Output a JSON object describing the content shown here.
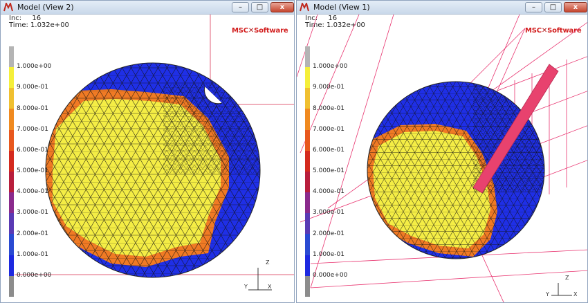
{
  "windows": [
    {
      "title": "Model (View 2)",
      "inc_label": "Inc:",
      "inc_value": "16",
      "time_label": "Time:",
      "time_value": "1.032e+00",
      "axis_labels": [
        "Z",
        "Y",
        "X"
      ]
    },
    {
      "title": "Model (View 1)",
      "inc_label": "Inc:",
      "inc_value": "16",
      "time_label": "Time:",
      "time_value": "1.032e+00",
      "axis_labels": [
        "Z",
        "Y",
        "X"
      ]
    }
  ],
  "controls": {
    "minimize": "–",
    "maximize": "□",
    "close": "x"
  },
  "logo": {
    "prefix": "MSC",
    "suffix": "Software"
  },
  "legend": {
    "labels": [
      "1.000e+00",
      "9.000e-01",
      "8.000e-01",
      "7.000e-01",
      "6.000e-01",
      "5.000e-01",
      "4.000e-01",
      "3.000e-01",
      "2.000e-01",
      "1.000e-01",
      "0.000e+00"
    ],
    "colors": [
      "#b4b4b4",
      "#f5ef3a",
      "#f0c030",
      "#f08a20",
      "#e8581e",
      "#d42a1e",
      "#b81e3c",
      "#8a2a8c",
      "#5a3ab4",
      "#2a4ad2",
      "#1d29e0",
      "#8c8c8c"
    ]
  },
  "colors": {
    "contour_high": "#f4ed45",
    "contour_mid": "#f07a24",
    "contour_low": "#1f2fe6",
    "grid_lines": "#e8326e",
    "tool": "#e8426e"
  }
}
